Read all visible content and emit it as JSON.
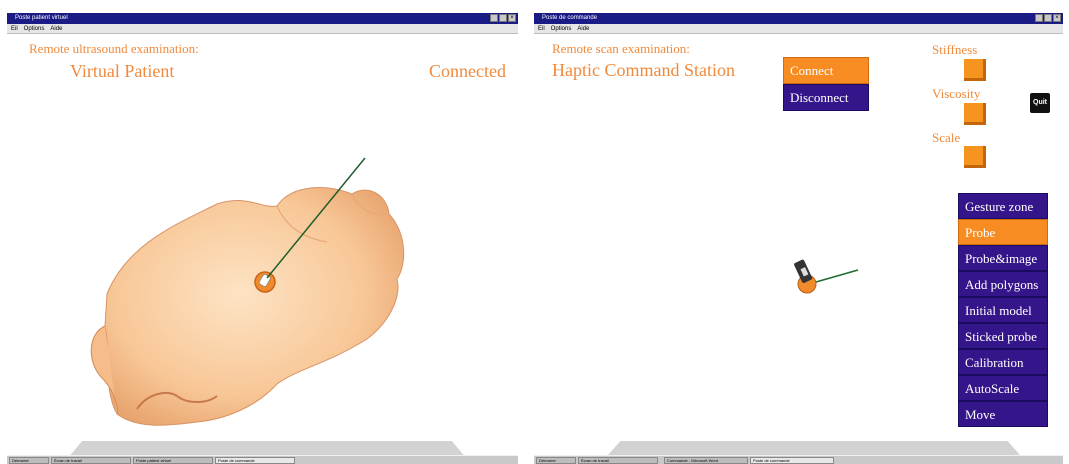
{
  "left_window": {
    "title": "Poste patient virtuel",
    "menu": [
      "Eil",
      "Options",
      "Aide"
    ],
    "header_small": "Remote ultrasound examination:",
    "header_big": "Virtual Patient",
    "status": "Connected",
    "taskbar": [
      "Démarrer",
      "Écran de travail",
      "Poste patient virtuel",
      "Poste de commande"
    ]
  },
  "right_window": {
    "title": "Poste de commande",
    "menu": [
      "Eil",
      "Options",
      "Aide"
    ],
    "header_small": "Remote scan examination:",
    "header_big": "Haptic Command Station",
    "connect_label": "Connect",
    "disconnect_label": "Disconnect",
    "stiffness_label": "Stiffness",
    "viscosity_label": "Viscosity",
    "scale_label": "Scale",
    "quit_label": "Quit",
    "mode_buttons": [
      {
        "label": "Gesture zone",
        "active": false
      },
      {
        "label": "Probe",
        "active": true
      },
      {
        "label": "Probe&image",
        "active": false
      },
      {
        "label": "Add polygons",
        "active": false
      },
      {
        "label": "Initial model",
        "active": false
      },
      {
        "label": "Sticked probe",
        "active": false
      },
      {
        "label": "Calibration",
        "active": false
      },
      {
        "label": "AutoScale",
        "active": false
      },
      {
        "label": "Move",
        "active": false
      }
    ],
    "taskbar": [
      "Démarrer",
      "Écran de travail",
      "Commande - Microsoft Word",
      "Poste de commande"
    ]
  },
  "colors": {
    "accent_orange": "#f08a3c",
    "button_purple": "#35168a",
    "button_orange": "#f78c22",
    "titlebar": "#1b1b86"
  }
}
